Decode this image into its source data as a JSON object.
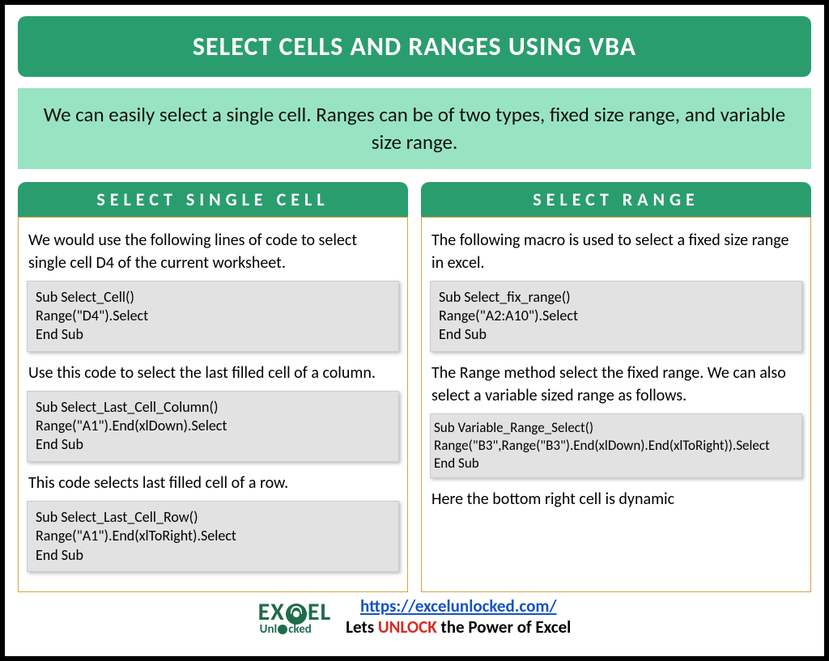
{
  "title": "SELECT CELLS AND RANGES USING VBA",
  "subtitle": "We can easily select a single cell. Ranges can be of two types, fixed size range, and variable size range.",
  "left": {
    "header": "SELECT SINGLE CELL",
    "p1": "We would use the following lines of code to select single cell D4 of the current worksheet.",
    "code1": "Sub Select_Cell()\nRange(\"D4\").Select\nEnd Sub",
    "p2": "Use this code to select the last filled cell of a column.",
    "code2": "Sub Select_Last_Cell_Column()\nRange(\"A1\").End(xlDown).Select\nEnd Sub",
    "p3": "This code selects last filled cell of a row.",
    "code3": "Sub Select_Last_Cell_Row()\nRange(\"A1\").End(xlToRight).Select\nEnd Sub"
  },
  "right": {
    "header": "SELECT RANGE",
    "p1": "The following macro is used to select a fixed size range in excel.",
    "code1": "Sub Select_fix_range()\nRange(\"A2:A10\").Select\nEnd Sub",
    "p2": "The Range method select the fixed range. We can also select a variable sized range as follows.",
    "code2": "Sub Variable_Range_Select()\nRange(\"B3\",Range(\"B3\").End(xlDown).End(xlToRight)).Select\nEnd Sub",
    "p3": "Here the bottom right cell is dynamic"
  },
  "footer": {
    "logo_top": "EX  EL",
    "logo_sub": "Unl  cked",
    "url": "https://excelunlocked.com/",
    "tagline_pre": "Lets ",
    "tagline_emph": "UNLOCK",
    "tagline_post": " the Power of Excel"
  }
}
